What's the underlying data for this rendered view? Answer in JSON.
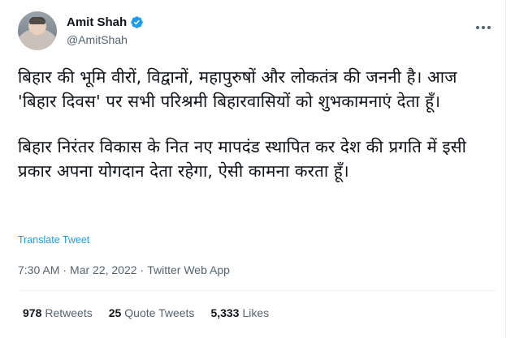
{
  "author": {
    "name": "Amit Shah",
    "handle": "@AmitShah",
    "verified": true
  },
  "tweet": {
    "paragraph1": "बिहार की भूमि वीरों, विद्वानों, महापुरुषों और लोकतंत्र की जननी है। आज 'बिहार दिवस' पर सभी परिश्रमी बिहारवासियों को शुभकामनाएं देता हूँ।",
    "paragraph2": "बिहार निरंतर विकास के नित नए मापदंड स्थापित कर देश की प्रगति में इसी प्रकार अपना योगदान देता रहेगा, ऐसी कामना करता हूँ।",
    "translate_label": "Translate Tweet",
    "time": "7:30 AM",
    "separator1": "·",
    "date": "Mar 22, 2022",
    "separator2": "·",
    "source": "Twitter Web App"
  },
  "stats": {
    "retweets_count": "978",
    "retweets_label": "Retweets",
    "quotes_count": "25",
    "quotes_label": "Quote Tweets",
    "likes_count": "5,333",
    "likes_label": "Likes"
  },
  "colors": {
    "link": "#1d9bf0",
    "secondary_text": "#536471",
    "verified_badge": "#1d9bf0"
  },
  "icons": {
    "more": "more-horizontal-icon",
    "verified": "verified-badge-icon"
  }
}
